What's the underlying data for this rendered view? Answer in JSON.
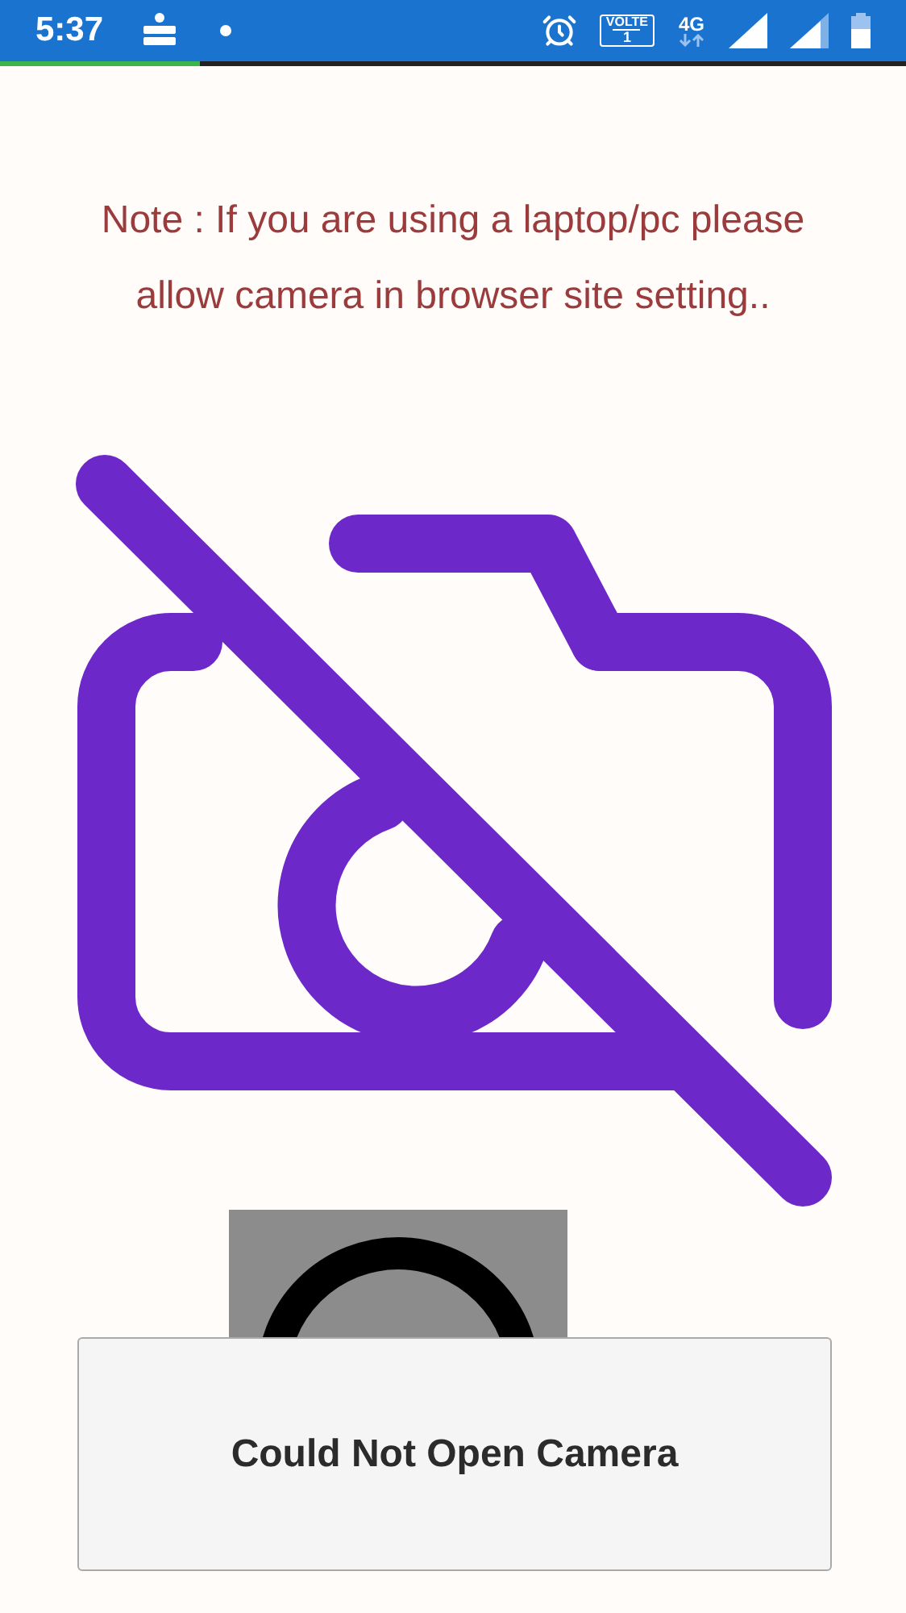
{
  "status_bar": {
    "time": "5:37",
    "volte_badge": {
      "label": "VOLTE",
      "sim": "1"
    },
    "network": "4G"
  },
  "loading_bar": {
    "level": 0.22
  },
  "note": "Note : If you are using a laptop/pc please allow camera in browser site setting..",
  "dialog": {
    "message": "Could Not Open Camera"
  }
}
